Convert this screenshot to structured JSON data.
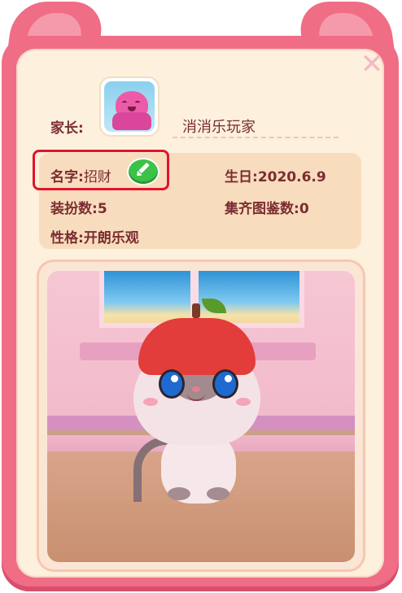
{
  "profile": {
    "parent_label": "家长:",
    "player_name": "消消乐玩家",
    "name_label": "名字:",
    "name_value": "招财",
    "birthday_label": "生日:",
    "birthday_value": "2020.6.9",
    "outfits_label": "装扮数:",
    "outfits_value": "5",
    "collection_label": "集齐图鉴数:",
    "collection_value": "0",
    "personality_label": "性格:",
    "personality_value": "开朗乐观"
  },
  "icons": {
    "close": "close-icon",
    "edit": "pencil-icon",
    "avatar": "octopus-avatar"
  },
  "colors": {
    "frame": "#f06d86",
    "card": "#fdf0dc",
    "text": "#7a2d31",
    "highlight": "#e0142c",
    "edit_button": "#3cc248"
  }
}
